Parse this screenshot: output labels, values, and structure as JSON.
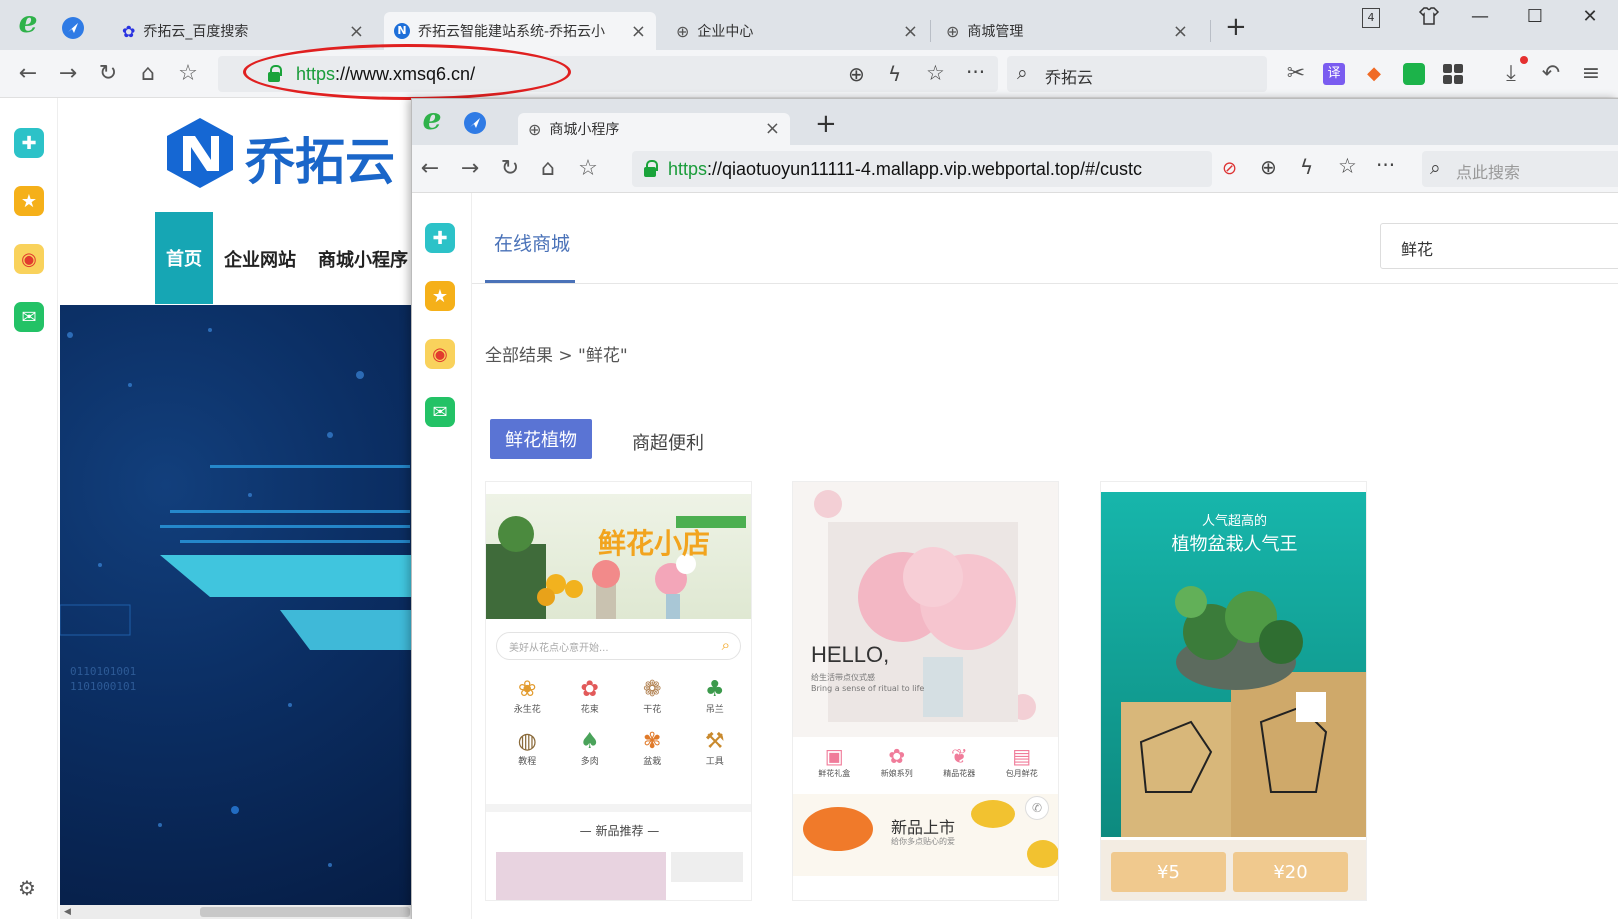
{
  "outer_browser": {
    "tabs": [
      {
        "label": "乔拓云_百度搜索",
        "icon": "baidu-paw-icon",
        "active": false
      },
      {
        "label": "乔拓云智能建站系统-乔拓云小",
        "icon": "qiaotuoyun-logo-icon",
        "active": true
      },
      {
        "label": "企业中心",
        "icon": "globe-icon",
        "active": false
      },
      {
        "label": "商城管理",
        "icon": "globe-icon",
        "active": false
      }
    ],
    "tab_count": "4",
    "url_scheme": "https",
    "url_rest": "://www.xmsq6.cn/",
    "search_text": "乔拓云"
  },
  "background_page": {
    "brand": "乔拓云",
    "nav": [
      "首页",
      "企业网站",
      "商城小程序"
    ]
  },
  "inner_browser": {
    "tab_label": "商城小程序",
    "url_scheme": "https",
    "url_rest": "://qiaotuoyun11111-4.mallapp.vip.webportal.top/#/custc",
    "search_placeholder": "点此搜索"
  },
  "mall": {
    "tab": "在线商城",
    "search_value": "鲜花",
    "breadcrumb": "全部结果 > \"鲜花\"",
    "categories": [
      "鲜花植物",
      "商超便利"
    ],
    "cards": [
      {
        "banner_text": "鲜花小店",
        "search_placeholder": "美好从花点心意开始...",
        "icons": [
          "永生花",
          "花束",
          "干花",
          "吊兰",
          "教程",
          "多肉",
          "盆栽",
          "工具"
        ],
        "section": "— 新品推荐 —"
      },
      {
        "hello": "HELLO,",
        "sub1": "给生活带点仪式感",
        "sub2": "Bring a sense of ritual to life",
        "icons": [
          "鲜花礼盒",
          "新娘系列",
          "精品花器",
          "包月鲜花"
        ],
        "new_text": "新品上市",
        "new_sub": "给你多点贴心的爱"
      },
      {
        "line1": "人气超高的",
        "line2": "植物盆栽人气王",
        "coupons": [
          "¥5",
          "¥20"
        ]
      }
    ]
  },
  "colors": {
    "accent_green": "#1a9c3a",
    "mall_blue": "#5a74d4",
    "teal": "#16a6b4",
    "ellipse_red": "#e02020"
  }
}
